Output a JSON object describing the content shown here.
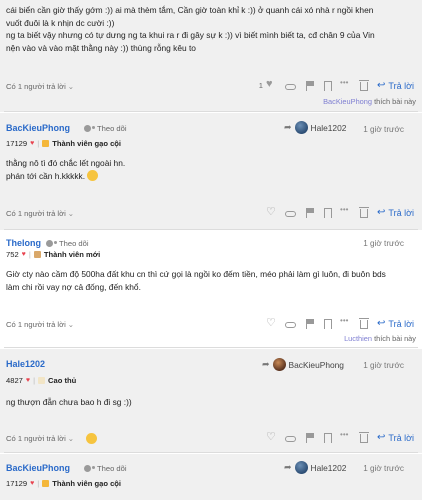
{
  "posts": [
    {
      "body_lines": [
        "cái biển cần giờ thấy gớm :)) ai mà thèm tắm, Cần giờ toàn khỉ k :)) ở quanh cái xó nhà r ngồi khen",
        "vuốt đuôi là k nhịn dc cười :))",
        "ng ta biết vậy nhưng có tự dưng ng ta khui ra r đi gây sự k :)) vì biết mình biết ta, cđ chân 9 của Vin",
        "nện vào và vào mặt thằng này :)) thùng rỗng kêu to"
      ],
      "replies_label": "Có 1 người trả lời",
      "like_count": "1",
      "reply_label": "Trả lời",
      "liked_by_user": "BacKieuPhong",
      "liked_by_suffix": "thích bài này"
    },
    {
      "author": "BacKieuPhong",
      "follow_label": "Theo dõi",
      "reply_to": "Hale1202",
      "time": "1 giờ trước",
      "points": "17129",
      "rank": "Thành viên gạo cội",
      "body_lines": [
        "thằng nô tì đó chắc lết ngoài hn.",
        "phán tới cần h.kkkkk."
      ],
      "replies_label": "Có 1 người trả lời",
      "reply_label": "Trả lời"
    },
    {
      "author": "Thelong",
      "follow_label": "Theo dõi",
      "time": "1 giờ trước",
      "points": "752",
      "rank": "Thành viên mới",
      "body_lines": [
        "Giờ cty nào cầm độ 500ha đất khu cn thì cứ gọi là ngồi ko đếm tiền, méo phải làm gì luôn, đi buôn bds",
        "làm chi rồi vay nợ cả đống, đến khổ."
      ],
      "replies_label": "Có 1 người trả lời",
      "reply_label": "Trả lời",
      "liked_by_user": "Lucthien",
      "liked_by_suffix": "thích bài này"
    },
    {
      "author": "Hale1202",
      "reply_to": "BacKieuPhong",
      "time": "1 giờ trước",
      "points": "4827",
      "rank": "Cao thủ",
      "body_lines": [
        "ng thượn đẫn chưa bao h đi sg :))"
      ],
      "replies_label": "Có 1 người trả lời",
      "reply_label": "Trả lời"
    },
    {
      "author": "BacKieuPhong",
      "follow_label": "Theo dõi",
      "reply_to": "Hale1202",
      "time": "1 giờ trước",
      "points": "17129",
      "rank": "Thành viên gạo cội"
    }
  ]
}
